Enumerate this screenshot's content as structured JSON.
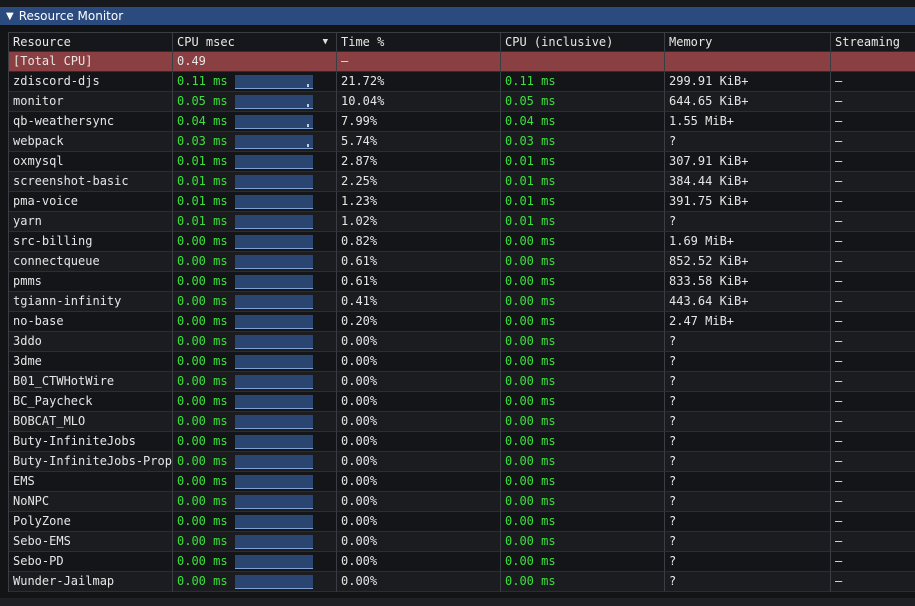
{
  "window": {
    "title": "Resource Monitor"
  },
  "columns": [
    "Resource",
    "CPU msec",
    "Time %",
    "CPU (inclusive)",
    "Memory",
    "Streaming"
  ],
  "sort_column": "Time %",
  "total": {
    "name": "[Total CPU]",
    "cpu": "0.49",
    "time": "–"
  },
  "rows": [
    {
      "name": "zdiscord-djs",
      "cpu": "0.11 ms",
      "time": "21.72%",
      "incl": "0.11 ms",
      "mem": "299.91 KiB+",
      "stream": "–",
      "blip": true
    },
    {
      "name": "monitor",
      "cpu": "0.05 ms",
      "time": "10.04%",
      "incl": "0.05 ms",
      "mem": "644.65 KiB+",
      "stream": "–",
      "blip": true
    },
    {
      "name": "qb-weathersync",
      "cpu": "0.04 ms",
      "time": "7.99%",
      "incl": "0.04 ms",
      "mem": "1.55 MiB+",
      "stream": "–",
      "blip": true
    },
    {
      "name": "webpack",
      "cpu": "0.03 ms",
      "time": "5.74%",
      "incl": "0.03 ms",
      "mem": "?",
      "stream": "–",
      "blip": true
    },
    {
      "name": "oxmysql",
      "cpu": "0.01 ms",
      "time": "2.87%",
      "incl": "0.01 ms",
      "mem": "307.91 KiB+",
      "stream": "–"
    },
    {
      "name": "screenshot-basic",
      "cpu": "0.01 ms",
      "time": "2.25%",
      "incl": "0.01 ms",
      "mem": "384.44 KiB+",
      "stream": "–"
    },
    {
      "name": "pma-voice",
      "cpu": "0.01 ms",
      "time": "1.23%",
      "incl": "0.01 ms",
      "mem": "391.75 KiB+",
      "stream": "–"
    },
    {
      "name": "yarn",
      "cpu": "0.01 ms",
      "time": "1.02%",
      "incl": "0.01 ms",
      "mem": "?",
      "stream": "–"
    },
    {
      "name": "src-billing",
      "cpu": "0.00 ms",
      "time": "0.82%",
      "incl": "0.00 ms",
      "mem": "1.69 MiB+",
      "stream": "–"
    },
    {
      "name": "connectqueue",
      "cpu": "0.00 ms",
      "time": "0.61%",
      "incl": "0.00 ms",
      "mem": "852.52 KiB+",
      "stream": "–"
    },
    {
      "name": "pmms",
      "cpu": "0.00 ms",
      "time": "0.61%",
      "incl": "0.00 ms",
      "mem": "833.58 KiB+",
      "stream": "–"
    },
    {
      "name": "tgiann-infinity",
      "cpu": "0.00 ms",
      "time": "0.41%",
      "incl": "0.00 ms",
      "mem": "443.64 KiB+",
      "stream": "–"
    },
    {
      "name": "no-base",
      "cpu": "0.00 ms",
      "time": "0.20%",
      "incl": "0.00 ms",
      "mem": "2.47 MiB+",
      "stream": "–"
    },
    {
      "name": "3ddo",
      "cpu": "0.00 ms",
      "time": "0.00%",
      "incl": "0.00 ms",
      "mem": "?",
      "stream": "–"
    },
    {
      "name": "3dme",
      "cpu": "0.00 ms",
      "time": "0.00%",
      "incl": "0.00 ms",
      "mem": "?",
      "stream": "–"
    },
    {
      "name": "B01_CTWHotWire",
      "cpu": "0.00 ms",
      "time": "0.00%",
      "incl": "0.00 ms",
      "mem": "?",
      "stream": "–"
    },
    {
      "name": "BC_Paycheck",
      "cpu": "0.00 ms",
      "time": "0.00%",
      "incl": "0.00 ms",
      "mem": "?",
      "stream": "–"
    },
    {
      "name": "BOBCAT_MLO",
      "cpu": "0.00 ms",
      "time": "0.00%",
      "incl": "0.00 ms",
      "mem": "?",
      "stream": "–"
    },
    {
      "name": "Buty-InfiniteJobs",
      "cpu": "0.00 ms",
      "time": "0.00%",
      "incl": "0.00 ms",
      "mem": "?",
      "stream": "–"
    },
    {
      "name": "Buty-InfiniteJobs-Prop",
      "cpu": "0.00 ms",
      "time": "0.00%",
      "incl": "0.00 ms",
      "mem": "?",
      "stream": "–"
    },
    {
      "name": "EMS",
      "cpu": "0.00 ms",
      "time": "0.00%",
      "incl": "0.00 ms",
      "mem": "?",
      "stream": "–"
    },
    {
      "name": "NoNPC",
      "cpu": "0.00 ms",
      "time": "0.00%",
      "incl": "0.00 ms",
      "mem": "?",
      "stream": "–"
    },
    {
      "name": "PolyZone",
      "cpu": "0.00 ms",
      "time": "0.00%",
      "incl": "0.00 ms",
      "mem": "?",
      "stream": "–"
    },
    {
      "name": "Sebo-EMS",
      "cpu": "0.00 ms",
      "time": "0.00%",
      "incl": "0.00 ms",
      "mem": "?",
      "stream": "–"
    },
    {
      "name": "Sebo-PD",
      "cpu": "0.00 ms",
      "time": "0.00%",
      "incl": "0.00 ms",
      "mem": "?",
      "stream": "–"
    },
    {
      "name": "Wunder-Jailmap",
      "cpu": "0.00 ms",
      "time": "0.00%",
      "incl": "0.00 ms",
      "mem": "?",
      "stream": "–"
    }
  ]
}
